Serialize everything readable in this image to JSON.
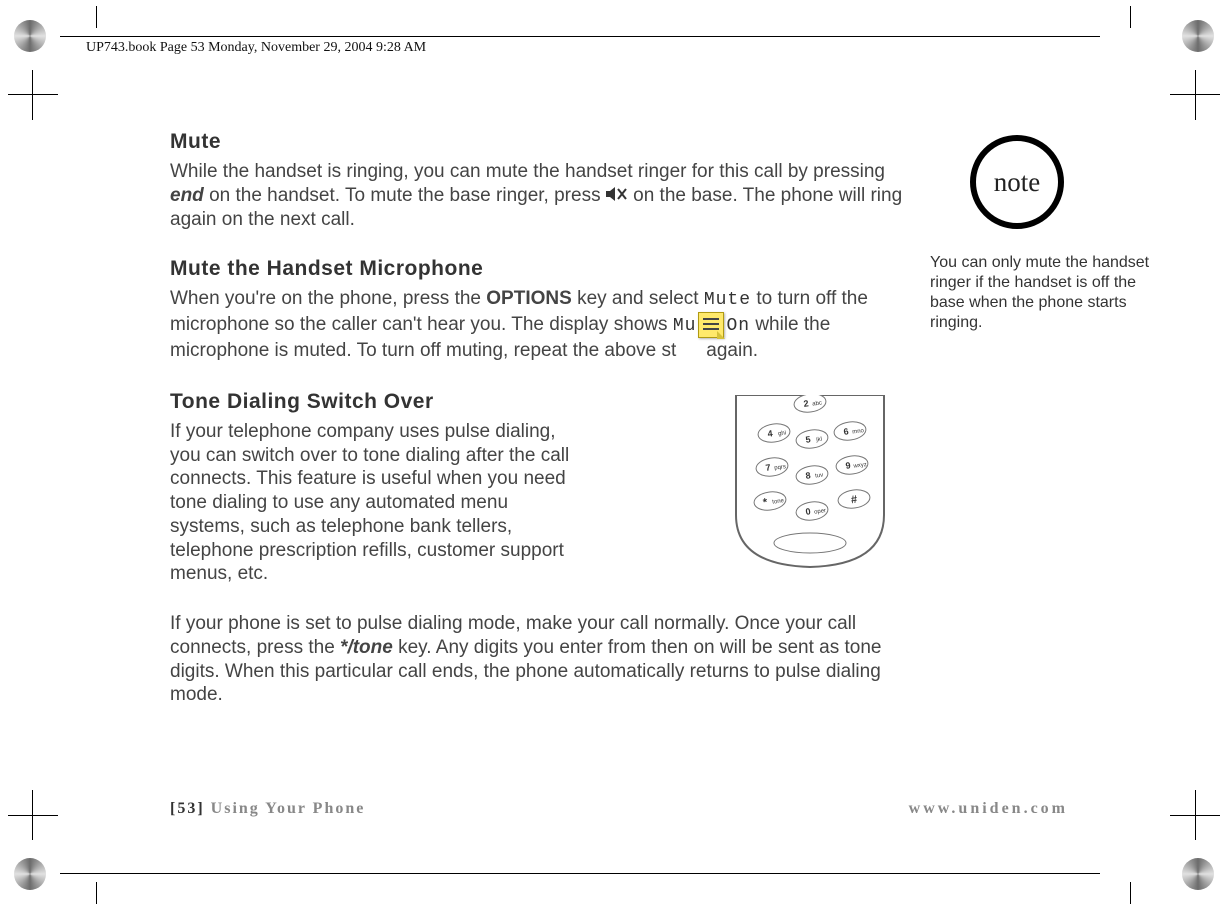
{
  "header_line": "UP743.book  Page 53  Monday, November 29, 2004  9:28 AM",
  "sections": {
    "mute": {
      "title": "Mute",
      "body_pre": "While the handset is ringing, you can mute the handset ringer for this call by pressing ",
      "end_key": "end",
      "body_mid": " on the handset. To mute the base ringer, press ",
      "body_post": " on the base. The phone will ring again on the next call."
    },
    "mute_mic": {
      "title": "Mute the Handset Microphone",
      "body_pre": "When you're on the phone, press the ",
      "options_key": "OPTIONS",
      "body_mid1": " key and select ",
      "lcd_mute": "Mute",
      "body_mid2": " to turn off the microphone so the caller can't hear you. The display shows ",
      "lcd_muteon_a": "Mu",
      "lcd_muteon_b": "On",
      "body_mid3": " while the microphone is muted. To turn off muting, repeat the above st",
      "body_post": "again."
    },
    "tonedial": {
      "title": "Tone Dialing Switch Over",
      "para1": "If your telephone company uses pulse dialing, you can switch over to tone dialing after the call connects. This feature is useful when you need tone dialing to use any automated menu systems, such as telephone bank tellers, telephone prescription refills, customer support menus, etc.",
      "para2_pre": "If your phone is set to pulse dialing mode, make your call normally. Once your call connects, press the ",
      "tone_key": "*/tone",
      "para2_post": " key. Any digits you enter from then on will be sent as tone digits. When this particular call ends, the phone automatically returns to pulse dialing mode."
    }
  },
  "phone_keys": [
    {
      "n": "2",
      "l": "abc"
    },
    {
      "n": "4",
      "l": "ghi"
    },
    {
      "n": "5",
      "l": "jkl"
    },
    {
      "n": "6",
      "l": "mno"
    },
    {
      "n": "7",
      "l": "pqrs"
    },
    {
      "n": "8",
      "l": "tuv"
    },
    {
      "n": "9",
      "l": "wxyz"
    },
    {
      "n": "*",
      "l": "tone"
    },
    {
      "n": "0",
      "l": "oper"
    },
    {
      "n": "#",
      "l": ""
    }
  ],
  "note": {
    "badge": "note",
    "text": "You can only mute the handset ringer if the handset is off the base when the phone starts ringing."
  },
  "footer": {
    "page_num": "[53]",
    "section": "Using Your Phone",
    "url": "www.uniden.com"
  }
}
